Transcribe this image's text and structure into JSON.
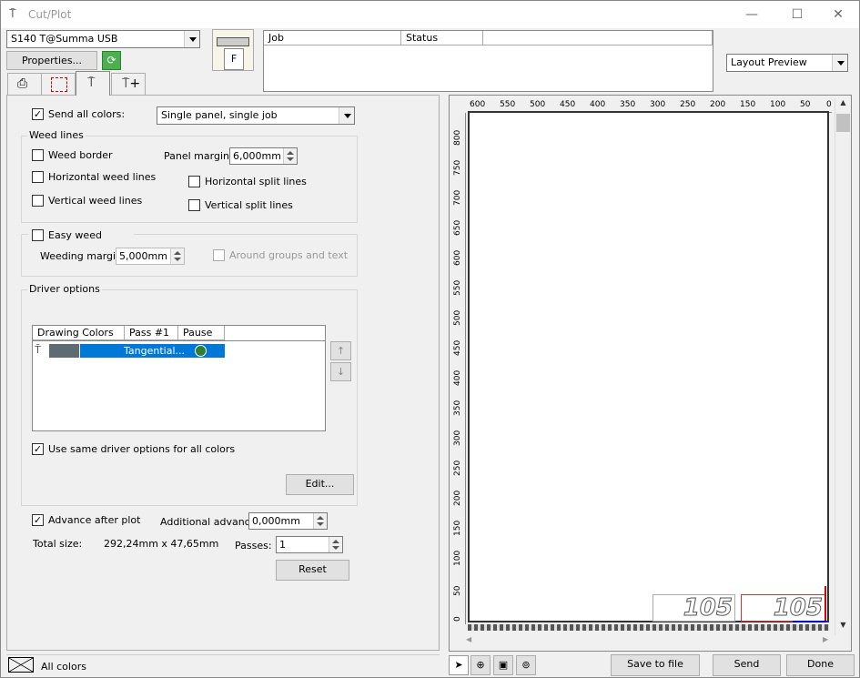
{
  "window": {
    "title": "Cut/Plot"
  },
  "device": {
    "selected": "S140 T@Summa USB",
    "properties_label": "Properties..."
  },
  "job_table": {
    "columns": [
      "Job",
      "Status"
    ]
  },
  "preview_select": {
    "selected": "Layout Preview"
  },
  "send_all_colors": {
    "label": "Send all colors:",
    "checked": true,
    "mode": "Single panel, single job"
  },
  "weed_lines": {
    "title": "Weed lines",
    "weed_border": "Weed border",
    "horizontal_weed": "Horizontal weed lines",
    "vertical_weed": "Vertical weed lines",
    "panel_margin_label": "Panel margin:",
    "panel_margin": "6,000mm",
    "horizontal_split": "Horizontal split lines",
    "vertical_split": "Vertical split lines"
  },
  "easy_weed": {
    "label": "Easy weed",
    "margin_label": "Weeding margin:",
    "margin": "5,000mm",
    "around_groups": "Around groups and text"
  },
  "driver": {
    "title": "Driver options",
    "columns": [
      "Drawing Colors",
      "Pass #1",
      "Pause"
    ],
    "row_mode": "Tangential...",
    "color": "#5f6d73",
    "same_options": "Use same driver options for all colors",
    "same_checked": true,
    "edit_label": "Edit..."
  },
  "advance": {
    "label": "Advance after plot",
    "checked": true,
    "additional_label": "Additional advance:",
    "additional": "0,000mm",
    "total_label": "Total size:",
    "total": "292,24mm x 47,65mm",
    "passes_label": "Passes:",
    "passes": "1",
    "reset_label": "Reset"
  },
  "ruler": {
    "h": [
      "600",
      "550",
      "500",
      "450",
      "400",
      "350",
      "300",
      "250",
      "200",
      "150",
      "100",
      "50",
      "0"
    ],
    "v": [
      "800",
      "750",
      "700",
      "650",
      "600",
      "550",
      "500",
      "450",
      "400",
      "350",
      "300",
      "250",
      "200",
      "150",
      "100",
      "50",
      "0"
    ]
  },
  "preview": {
    "labels": [
      "105",
      "105"
    ]
  },
  "footer": {
    "colors_label": "All colors",
    "save_label": "Save to file",
    "send_label": "Send",
    "done_label": "Done"
  }
}
